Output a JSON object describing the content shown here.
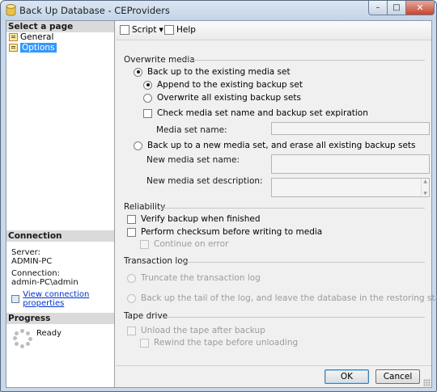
{
  "window": {
    "title": "Back Up Database - CEProviders",
    "minimize_glyph": "–",
    "maximize_glyph": "□",
    "close_glyph": "✕"
  },
  "left_pane": {
    "select_page_header": "Select a page",
    "pages": [
      {
        "label": "General",
        "icon": "page-icon",
        "selected": false
      },
      {
        "label": "Options",
        "icon": "page-icon",
        "selected": true
      }
    ],
    "connection_header": "Connection",
    "server_label": "Server:",
    "server_value": "ADMIN-PC",
    "connection_label": "Connection:",
    "connection_value": "admin-PC\\admin",
    "view_connection_link": "View connection properties",
    "progress_header": "Progress",
    "progress_status": "Ready"
  },
  "toolbar": {
    "script_label": "Script",
    "caret": "▼",
    "help_label": "Help"
  },
  "overwrite_media": {
    "title": "Overwrite media",
    "backup_existing_label": "Back up to the existing media set",
    "backup_existing_selected": true,
    "append_label": "Append to the existing backup set",
    "append_selected": true,
    "overwrite_label": "Overwrite all existing backup sets",
    "overwrite_selected": false,
    "check_media_label": "Check media set name and backup set expiration",
    "check_media_checked": false,
    "media_set_name_label": "Media set name:",
    "media_set_name_value": "",
    "backup_new_label": "Back up to a new media set, and erase all existing backup sets",
    "backup_new_selected": false,
    "new_media_name_label": "New media set name:",
    "new_media_name_value": "",
    "new_media_desc_label": "New media set description:",
    "new_media_desc_value": "",
    "scroll_up": "▲",
    "scroll_down": "▼"
  },
  "reliability": {
    "title": "Reliability",
    "verify_label": "Verify backup when finished",
    "verify_checked": false,
    "checksum_label": "Perform checksum before writing to media",
    "checksum_checked": false,
    "continue_on_error_label": "Continue on error",
    "continue_on_error_checked": false
  },
  "transaction_log": {
    "title": "Transaction log",
    "truncate_label": "Truncate the transaction log",
    "backup_tail_label": "Back up the tail of the log, and leave the database in the restoring state"
  },
  "tape_drive": {
    "title": "Tape drive",
    "unload_label": "Unload the tape after backup",
    "rewind_label": "Rewind the tape before unloading"
  },
  "footer": {
    "ok_label": "OK",
    "cancel_label": "Cancel"
  },
  "colors": {
    "selection": "#3399ff",
    "link": "#0033cc",
    "disabled_text": "#9c9c9c",
    "close_button": "#c5462f"
  }
}
